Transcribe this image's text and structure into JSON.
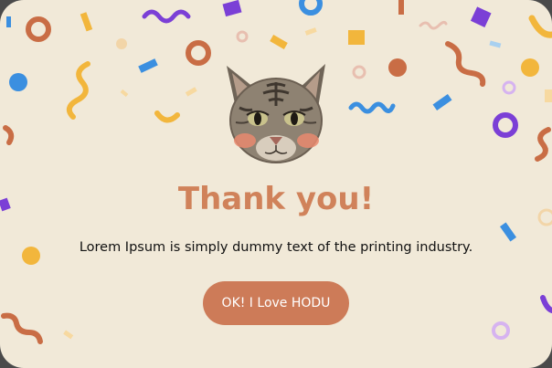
{
  "dialog": {
    "title": "Thank you!",
    "message": "Lorem Ipsum is simply dummy text of the printing industry.",
    "button_label": "OK! I Love HODU"
  },
  "colors": {
    "background": "#f1e9d8",
    "accent": "#cd7b58",
    "title": "#d0825a",
    "confetti_purple": "#7b3fd6",
    "confetti_blue": "#3b8fe0",
    "confetti_orange": "#c96d45",
    "confetti_yellow": "#f2b63c",
    "confetti_pink": "#e8bfb0"
  },
  "icons": {
    "cat": "cat-face-image",
    "confetti": "confetti-decoration"
  }
}
